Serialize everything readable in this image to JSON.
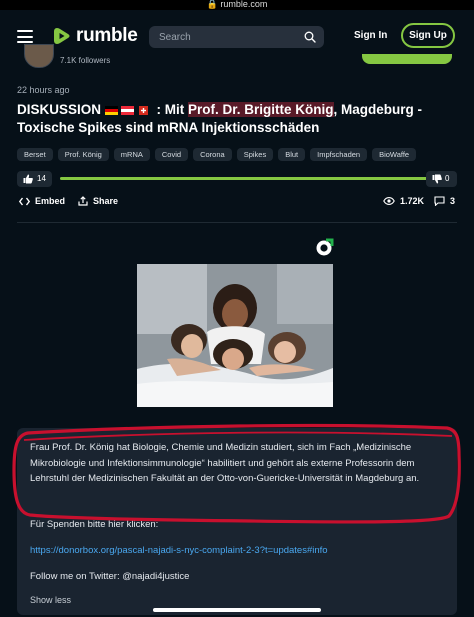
{
  "status_bar": {
    "url": "rumble.com"
  },
  "header": {
    "logo_text": "rumble",
    "search_placeholder": "Search",
    "signin_label": "Sign In",
    "signup_label": "Sign Up"
  },
  "channel": {
    "followers": "7.1K followers"
  },
  "video": {
    "posted": "22 hours ago",
    "title_prefix": "DISKUSSION",
    "title_sep": " : Mit ",
    "title_highlight": "Prof. Dr. Brigitte König",
    "title_suffix": ", Magdeburg - Toxische Spikes sind mRNA Injektionsschäden",
    "tags": [
      "Berset",
      "Prof. König",
      "mRNA",
      "Covid",
      "Corona",
      "Spikes",
      "Blut",
      "Impfschaden",
      "BioWaffe"
    ],
    "likes": "14",
    "dislikes": "0",
    "like_ratio": 1.0,
    "embed_label": "Embed",
    "share_label": "Share",
    "views": "1.72K",
    "comments": "3"
  },
  "description": {
    "paragraph": "Frau Prof. Dr. König hat Biologie, Chemie und Medizin studiert, sich im Fach „Medizinische Mikrobiologie und Infektionsimmunologie“ habilitiert und gehört als externe Professorin dem Lehrstuhl der Medizinischen Fakultät an der Otto-von-Guericke-Universität in Magdeburg an.",
    "donate": "Für Spenden bitte hier klicken:",
    "donate_link": "https://donorbox.org/pascal-najadi-s-nyc-complaint-2-3?t=updates#info",
    "twitter": "Follow me on Twitter: @najadi4justice",
    "show_less": "Show less"
  },
  "colors": {
    "brand": "#85c742",
    "background": "#061018",
    "panel": "#1a2430",
    "link": "#4aa8f0",
    "annotation": "#c8102e"
  }
}
